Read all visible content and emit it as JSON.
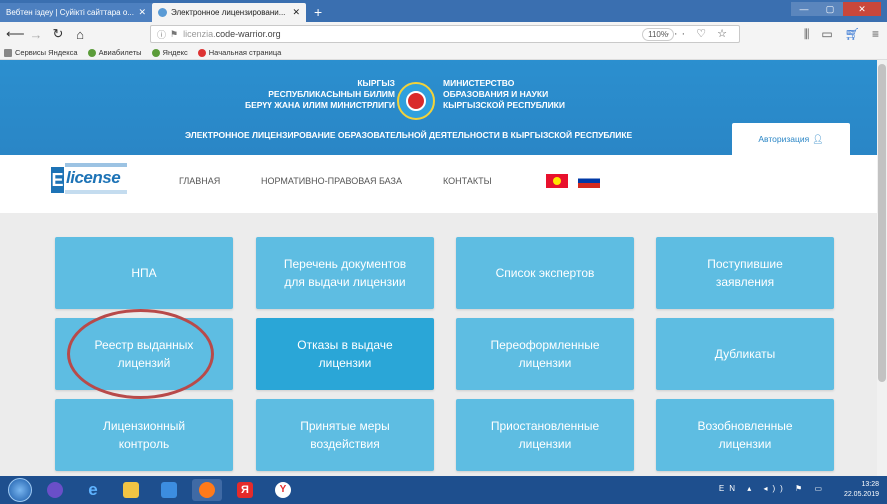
{
  "browser": {
    "tabs": [
      {
        "title": "Вебтен іздеу | Cyйiктi caйттaрa o...",
        "active": false
      },
      {
        "title": "Электронное лицензировани...",
        "active": true
      }
    ],
    "new_tab": "+",
    "url_domain": "licenzia.",
    "url_rest": "code-warrior.org",
    "zoom": "110%",
    "url_icons": "··· ♡ ☆",
    "bookmarks": [
      "Сервисы Яндекса",
      "Авиабилеты",
      "Яндекс",
      "Начальная страница"
    ]
  },
  "site": {
    "header_left": [
      "КЫРГЫЗ",
      "РЕСПУБЛИКАСЫНЫН БИЛИМ",
      "БЕРҮҮ ЖАНА ИЛИМ МИНИСТРЛИГИ"
    ],
    "header_right": [
      "МИНИСТЕРСТВО",
      "ОБРАЗОВАНИЯ И НАУКИ",
      "КЫРГЫЗСКОЙ РЕСПУБЛИКИ"
    ],
    "subtitle": "ЭЛЕКТРОННОЕ ЛИЦЕНЗИРОВАНИЕ ОБРАЗОВАТЕЛЬНОЙ ДЕЯТЕЛЬНОСТИ В КЫРГЫЗСКОЙ РЕСПУБЛИКЕ",
    "auth_label": "Авторизация",
    "logo_text": "license",
    "logo_initial": "E",
    "nav": [
      "ГЛАВНАЯ",
      "НОРМАТИВНО-ПРАВОВАЯ БАЗА",
      "КОНТАКТЫ"
    ]
  },
  "tiles": [
    [
      "НПА",
      "Перечень документов\nдля выдачи лицензии",
      "Список экспертов",
      "Поступившие\nзаявления"
    ],
    [
      "Реестр выданных\nлицензий",
      "Отказы в выдаче\nлицензии",
      "Переоформленные\nлицензии",
      "Дубликаты"
    ],
    [
      "Лицензионный\nконтроль",
      "Принятые меры\nвоздействия",
      "Приостановленные\nлицензии",
      "Возобновленные\nлицензии"
    ]
  ],
  "taskbar": {
    "lang": "EN",
    "time": "13:28",
    "date": "22.05.2019"
  }
}
